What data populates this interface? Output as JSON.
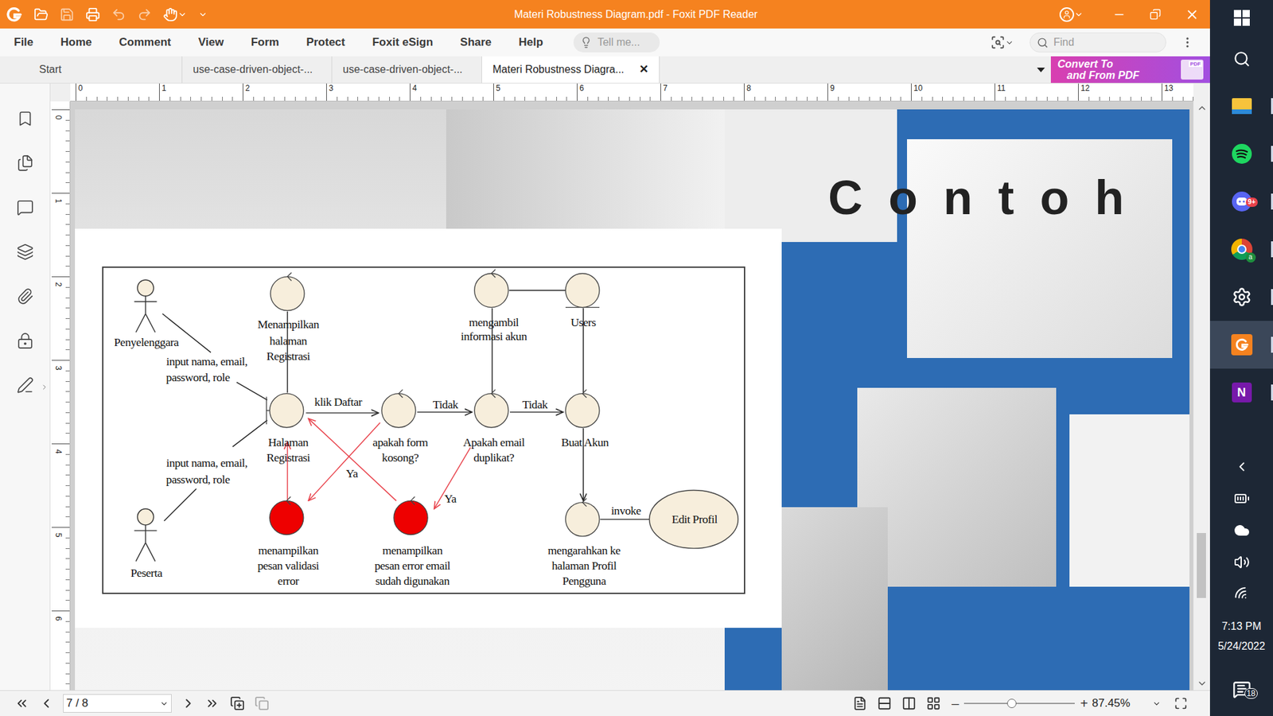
{
  "window": {
    "title": "Materi Robustness Diagram.pdf - Foxit PDF Reader"
  },
  "menu": {
    "items": [
      "File",
      "Home",
      "Comment",
      "View",
      "Form",
      "Protect",
      "Foxit eSign",
      "Share",
      "Help"
    ],
    "tell_me": "Tell me...",
    "find": "Find"
  },
  "tabs": [
    {
      "label": "Start",
      "selected": false
    },
    {
      "label": "use-case-driven-object-...",
      "selected": false
    },
    {
      "label": "use-case-driven-object-...",
      "selected": false
    },
    {
      "label": "Materi Robustness Diagra...",
      "selected": true,
      "close": "✕"
    }
  ],
  "convert_banner": {
    "lines": [
      "Convert To",
      "and From PDF"
    ],
    "badge": "PDF"
  },
  "ruler": {
    "horizontal": [
      "0",
      "1",
      "2",
      "3",
      "4",
      "5",
      "6",
      "7",
      "8",
      "9",
      "10",
      "11",
      "12",
      "13"
    ],
    "vertical": [
      "0",
      "1",
      "2",
      "3",
      "4",
      "5",
      "6"
    ]
  },
  "slide": {
    "title": "Contoh",
    "diagram": {
      "nodes": [
        {
          "kind": "actor",
          "label": [
            "Penyelenggara"
          ],
          "color": "#f7eedc"
        },
        {
          "kind": "actor",
          "label": [
            "Peserta"
          ],
          "color": "#f7eedc"
        },
        {
          "kind": "control",
          "label": [
            "Menampilkan",
            "halaman",
            "Registrasi"
          ],
          "color": "#f7eedc"
        },
        {
          "kind": "boundary",
          "label": [
            "Halaman",
            "Registrasi"
          ],
          "color": "#f7eedc"
        },
        {
          "kind": "control",
          "label": [
            "apakah form",
            "kosong?"
          ],
          "color": "#f7eedc"
        },
        {
          "kind": "control",
          "label": [
            "Apakah email",
            "duplikat?"
          ],
          "color": "#f7eedc"
        },
        {
          "kind": "control",
          "label": [
            "Buat Akun"
          ],
          "color": "#f7eedc"
        },
        {
          "kind": "control",
          "label": [
            "mengambil",
            "informasi akun"
          ],
          "color": "#f7eedc"
        },
        {
          "kind": "entity",
          "label": [
            "Users"
          ],
          "color": "#f7eedc"
        },
        {
          "kind": "control",
          "label": [
            "menampilkan",
            "pesan validasi",
            "error"
          ],
          "color": "#ee0000"
        },
        {
          "kind": "control",
          "label": [
            "menampilkan",
            "pesan error email",
            "sudah digunakan"
          ],
          "color": "#ee0000"
        },
        {
          "kind": "control",
          "label": [
            "mengarahkan ke",
            "halaman Profil",
            "Pengguna"
          ],
          "color": "#f7eedc"
        },
        {
          "kind": "usecase",
          "label": [
            "Edit Profil"
          ],
          "color": "#f7eedc"
        }
      ],
      "edges": [
        {
          "label": [
            "input nama, email,",
            "password, role"
          ],
          "color": "#222222",
          "arrow": false
        },
        {
          "label": [
            "input nama, email,",
            "password, role"
          ],
          "color": "#222222",
          "arrow": false
        },
        {
          "label": [],
          "color": "#222222",
          "arrow": false
        },
        {
          "label": [
            "klik Daftar"
          ],
          "color": "#222222",
          "arrow": true
        },
        {
          "label": [
            "Tidak"
          ],
          "color": "#222222",
          "arrow": true
        },
        {
          "label": [
            "Tidak"
          ],
          "color": "#222222",
          "arrow": true
        },
        {
          "label": [],
          "color": "#222222",
          "arrow": false
        },
        {
          "label": [],
          "color": "#222222",
          "arrow": false
        },
        {
          "label": [],
          "color": "#222222",
          "arrow": false
        },
        {
          "label": [],
          "color": "#222222",
          "arrow": true
        },
        {
          "label": [
            "invoke"
          ],
          "color": "#222222",
          "arrow": false
        },
        {
          "label": [],
          "color": "#e8414a",
          "arrow": true
        },
        {
          "label": [
            "Ya"
          ],
          "color": "#e8414a",
          "arrow": true
        },
        {
          "label": [],
          "color": "#e8414a",
          "arrow": true
        },
        {
          "label": [
            "Ya"
          ],
          "color": "#e8414a",
          "arrow": true
        }
      ]
    }
  },
  "status_bar": {
    "page": "7 / 8",
    "zoom": "87.45%",
    "zoom_out": "–",
    "zoom_in": "+",
    "zoom_level": 0.43
  },
  "taskbar": {
    "apps": [
      {
        "kind": "explorer",
        "selected": false
      },
      {
        "kind": "spotify",
        "selected": false
      },
      {
        "kind": "discord",
        "selected": false,
        "badge": "9+"
      },
      {
        "kind": "chrome",
        "selected": false,
        "profile": "a"
      },
      {
        "kind": "settings",
        "selected": false
      },
      {
        "kind": "foxit",
        "selected": true
      },
      {
        "kind": "onenote",
        "selected": false,
        "glyph": "N"
      }
    ],
    "time": "7:13 PM",
    "date": "5/24/2022",
    "notifications": "18"
  }
}
